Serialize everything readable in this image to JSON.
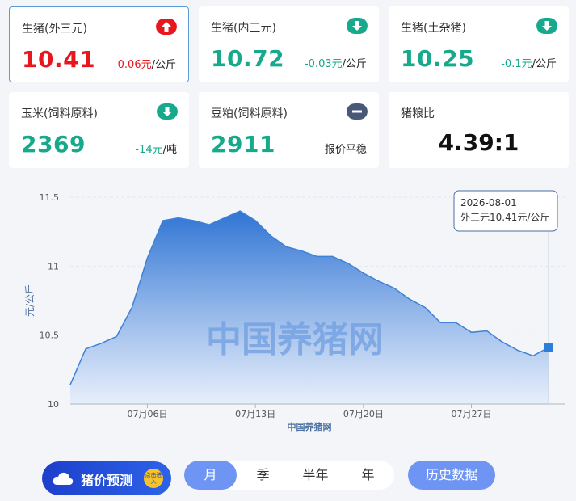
{
  "cards": [
    {
      "label": "生猪(外三元)",
      "price": "10.41",
      "delta": "0.06元",
      "unit": "/公斤",
      "trend": "up"
    },
    {
      "label": "生猪(内三元)",
      "price": "10.72",
      "delta": "-0.03元",
      "unit": "/公斤",
      "trend": "down"
    },
    {
      "label": "生猪(土杂猪)",
      "price": "10.25",
      "delta": "-0.1元",
      "unit": "/公斤",
      "trend": "down"
    },
    {
      "label": "玉米(饲料原料)",
      "price": "2369",
      "delta": "-14元",
      "unit": "/吨",
      "trend": "down"
    },
    {
      "label": "豆粕(饲料原料)",
      "price": "2911",
      "status": "报价平稳",
      "trend": "flat"
    },
    {
      "label": "猪粮比",
      "ratio": "4.39:1"
    }
  ],
  "colors": {
    "up": "#e7171d",
    "down": "#16a98c",
    "flat": "#4a5878",
    "accent": "#6f95f4",
    "series": "#3d82d6"
  },
  "chart_data": {
    "type": "area",
    "ylabel": "元/公斤",
    "xlabel": "中国养猪网",
    "watermark": "中国养猪网",
    "ylim": [
      10,
      11.5
    ],
    "yticks": [
      "10",
      "10.5",
      "11",
      "11.5"
    ],
    "xticks": [
      {
        "day": 6,
        "label": "07月06日"
      },
      {
        "day": 13,
        "label": "07月13日"
      },
      {
        "day": 20,
        "label": "07月20日"
      },
      {
        "day": 27,
        "label": "07月27日"
      }
    ],
    "grid": true,
    "series": [
      {
        "x": [
          1,
          2,
          3,
          4,
          5,
          6,
          7,
          8,
          9,
          10,
          11,
          12,
          13,
          14,
          15,
          16,
          17,
          18,
          19,
          20,
          21,
          22,
          23,
          24,
          25,
          26,
          27,
          28,
          29,
          30,
          31,
          32
        ],
        "values": [
          10.14,
          10.4,
          10.44,
          10.49,
          10.7,
          11.06,
          11.33,
          11.35,
          11.33,
          11.3,
          11.35,
          11.4,
          11.33,
          11.22,
          11.14,
          11.11,
          11.07,
          11.07,
          11.02,
          10.95,
          10.89,
          10.84,
          10.76,
          10.7,
          10.59,
          10.59,
          10.52,
          10.53,
          10.45,
          10.39,
          10.35,
          10.41
        ]
      }
    ],
    "tooltip": {
      "date": "2026-08-01",
      "text": "外三元10.41元/公斤"
    }
  },
  "bottom": {
    "forecast_label": "猪价预测",
    "forecast_badge": "点击进入",
    "periods": [
      "月",
      "季",
      "半年",
      "年"
    ],
    "selected_period": "月",
    "history_label": "历史数据"
  }
}
